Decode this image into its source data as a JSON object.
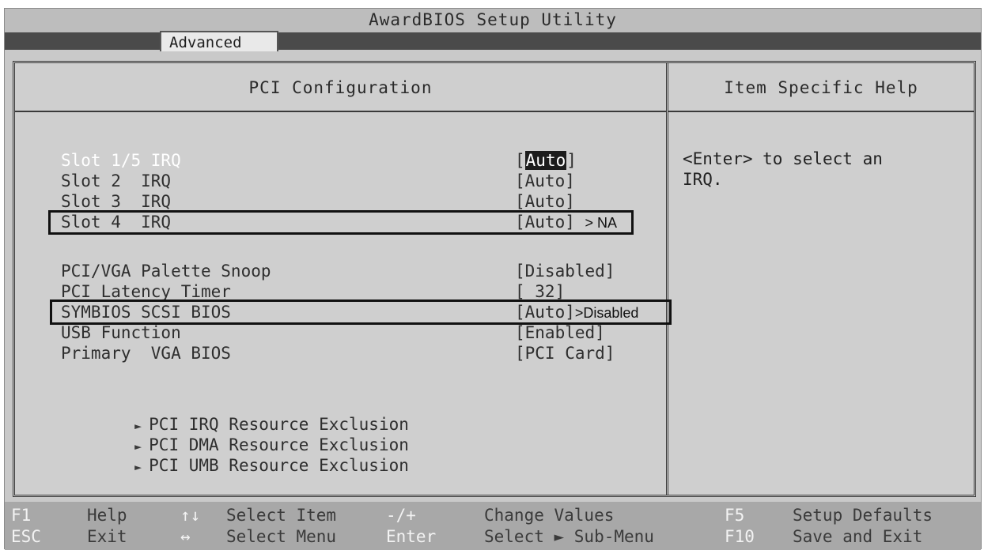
{
  "app": {
    "title": "AwardBIOS Setup Utility"
  },
  "tabs": {
    "active": "Advanced"
  },
  "main": {
    "header": "PCI Configuration",
    "settings": [
      {
        "label": "Slot 1/5 IRQ",
        "value_prefix": "[",
        "value_highlight": "Auto",
        "value_suffix": "]"
      },
      {
        "label": "Slot 2  IRQ",
        "value": "[Auto]"
      },
      {
        "label": "Slot 3  IRQ",
        "value": "[Auto]"
      },
      {
        "label": "Slot 4  IRQ",
        "value": "[Auto]",
        "annotation": "> NA"
      },
      {
        "label": "PCI/VGA Palette Snoop",
        "value": "[Disabled]"
      },
      {
        "label": "PCI Latency Timer",
        "value": "[ 32]"
      },
      {
        "label": "SYMBIOS SCSI BIOS",
        "value": "[Auto]",
        "annotation": ">Disabled"
      },
      {
        "label": "USB Function",
        "value": "[Enabled]"
      },
      {
        "label": "Primary  VGA BIOS",
        "value": "[PCI Card]"
      }
    ],
    "submenus": [
      "PCI IRQ Resource Exclusion",
      "PCI DMA Resource Exclusion",
      "PCI UMB Resource Exclusion"
    ]
  },
  "help": {
    "header": "Item Specific Help",
    "text": "<Enter> to select an\nIRQ."
  },
  "keybar": {
    "f1_key": "F1",
    "f1_desc": "Help",
    "updown_key": "↑↓",
    "updown_desc": "Select Item",
    "minusplus_key": "-/+",
    "minusplus_desc": "Change Values",
    "f5_key": "F5",
    "f5_desc": "Setup Defaults",
    "esc_key": "ESC",
    "esc_desc": "Exit",
    "leftright_key": "↔",
    "leftright_desc": "Select Menu",
    "enter_key": "Enter",
    "enter_desc": "Select ► Sub-Menu",
    "f10_key": "F10",
    "f10_desc": "Save and Exit"
  }
}
